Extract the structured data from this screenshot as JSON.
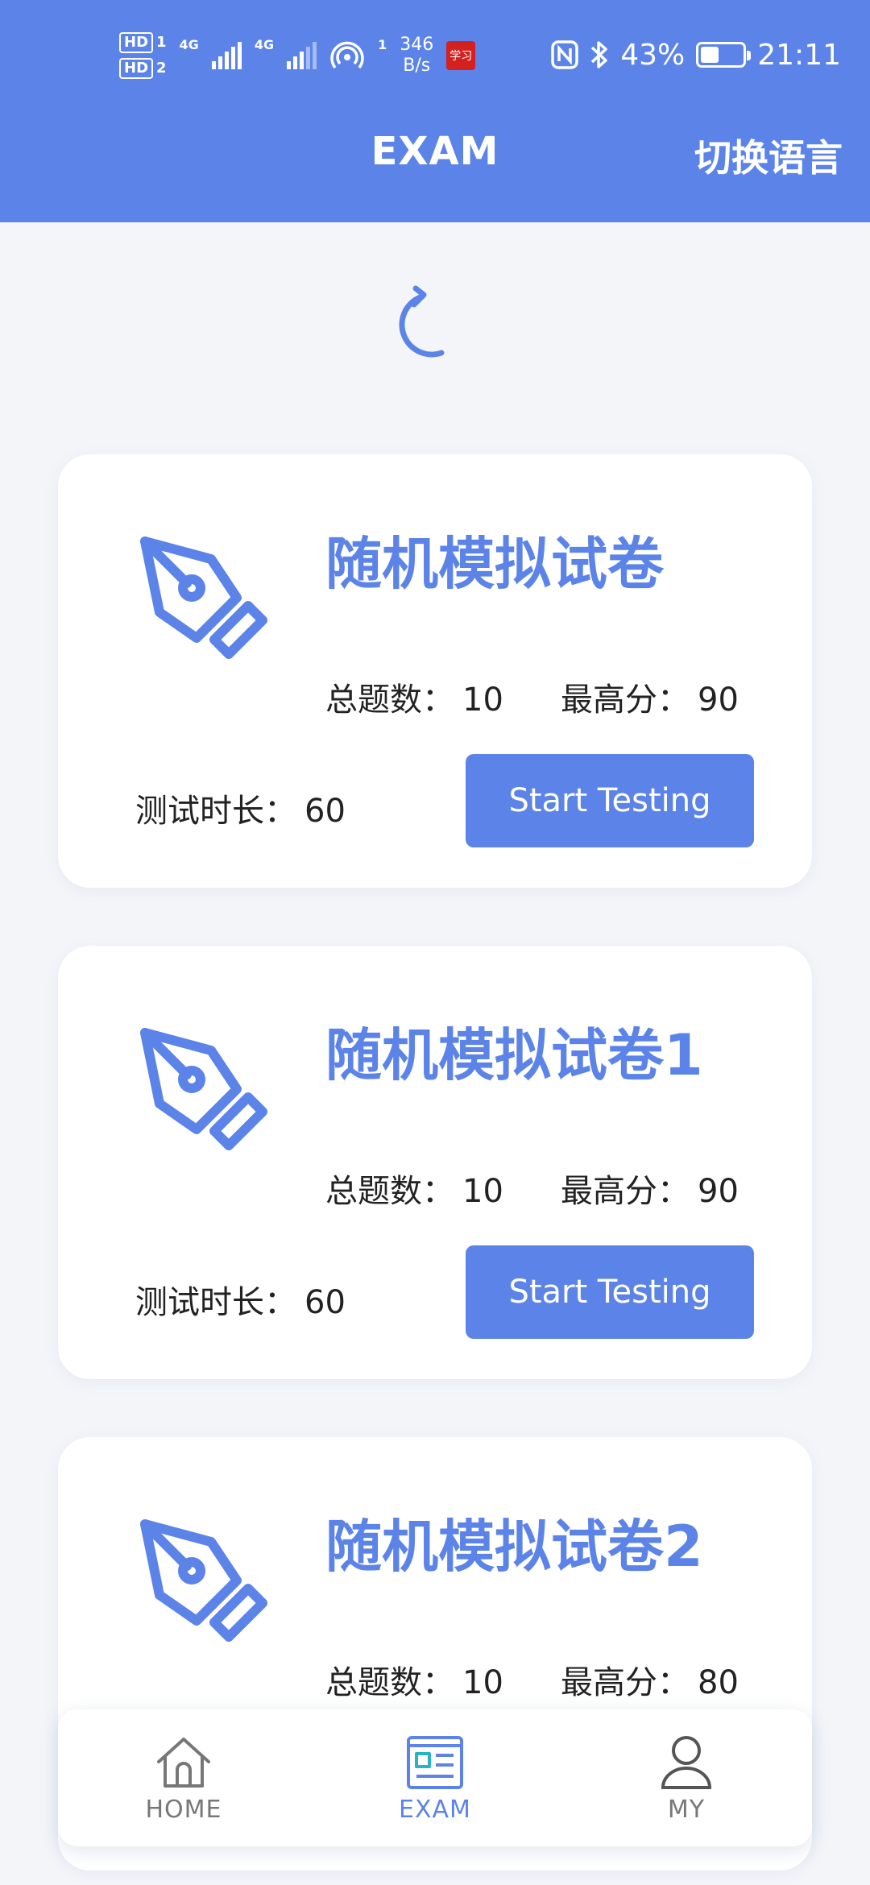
{
  "status_bar": {
    "hd1": "HD",
    "sim1": "1",
    "hd2": "HD",
    "sim2": "2",
    "net1": "4G",
    "net2": "4G",
    "hotspot": "1",
    "speed_value": "346",
    "speed_unit": "B/s",
    "app_badge": "学习",
    "nfc_icon": "nfc-icon",
    "bluetooth_icon": "bluetooth-icon",
    "battery_percent": "43%",
    "battery_level": 0.43,
    "time": "21:11"
  },
  "header": {
    "title": "EXAM",
    "language_switch": "切换语言",
    "background_color": "#5c84e8"
  },
  "refresh_icon": "refresh-icon",
  "exams": [
    {
      "title": "随机模拟试卷",
      "total_label": "总题数：",
      "total_value": "10",
      "max_label": "最高分：",
      "max_value": "90",
      "duration_label": "测试时长：",
      "duration_value": "60",
      "button_label": "Start Testing",
      "icon": "pen-nib-icon"
    },
    {
      "title": "随机模拟试卷1",
      "total_label": "总题数：",
      "total_value": "10",
      "max_label": "最高分：",
      "max_value": "90",
      "duration_label": "测试时长：",
      "duration_value": "60",
      "button_label": "Start Testing",
      "icon": "pen-nib-icon"
    },
    {
      "title": "随机模拟试卷2",
      "total_label": "总题数：",
      "total_value": "10",
      "max_label": "最高分：",
      "max_value": "80",
      "icon": "pen-nib-icon"
    }
  ],
  "bottom_nav": [
    {
      "label": "HOME",
      "icon": "home-icon",
      "active": false
    },
    {
      "label": "EXAM",
      "icon": "exam-icon",
      "active": true
    },
    {
      "label": "MY",
      "icon": "user-icon",
      "active": false
    }
  ],
  "colors": {
    "accent": "#5c84e8",
    "page_background": "#f3f5f9",
    "card_background": "#ffffff",
    "text": "#222222",
    "nav_inactive": "#777777"
  }
}
